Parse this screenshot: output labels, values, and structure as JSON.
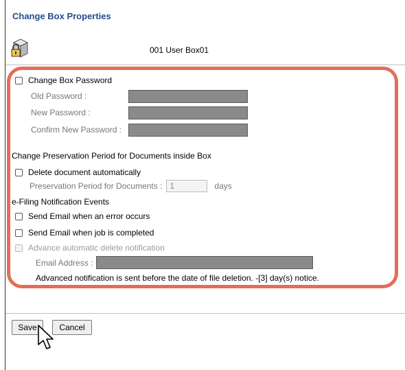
{
  "page": {
    "title": "Change Box Properties",
    "box_name": "001 User Box01"
  },
  "password": {
    "change_label": "Change Box Password",
    "old_label": "Old Password :",
    "new_label": "New Password :",
    "confirm_label": "Confirm New Password :"
  },
  "preservation": {
    "heading": "Change Preservation Period for Documents inside Box",
    "delete_auto_label": "Delete document automatically",
    "period_label": "Preservation Period for Documents :",
    "period_value": "1",
    "period_unit": "days"
  },
  "notifications": {
    "heading": "e-Filing Notification Events",
    "error_label": "Send Email when an error occurs",
    "completed_label": "Send Email when job is completed",
    "advance_delete_label": "Advance automatic delete notification",
    "email_label": "Email Address :",
    "advance_note": "Advanced notification is sent before the date of file deletion. -[3] day(s) notice."
  },
  "actions": {
    "save_label": "Save",
    "cancel_label": "Cancel"
  },
  "colors": {
    "title": "#2a4b8d",
    "highlight": "#e26e5a",
    "field_fill": "#8a8a8a"
  }
}
